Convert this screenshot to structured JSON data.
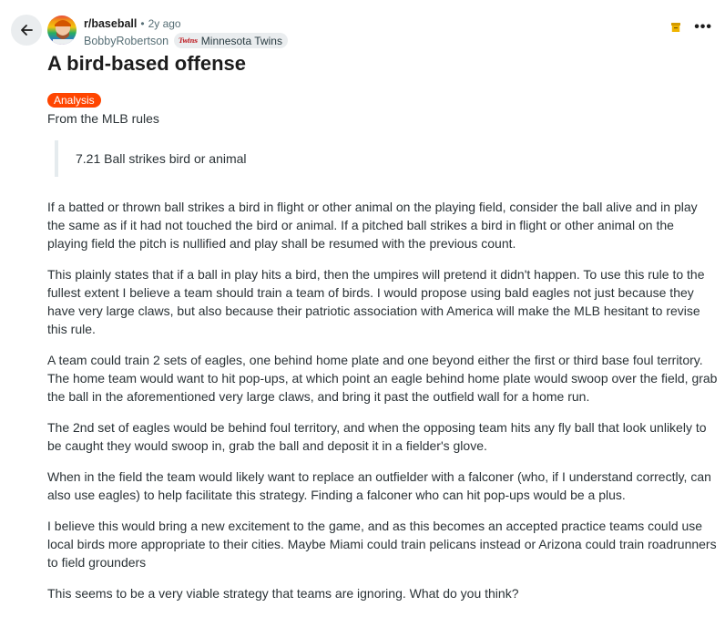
{
  "header": {
    "back_icon": "arrow-left-icon",
    "subreddit": "r/baseball",
    "separator": "•",
    "timestamp": "2y ago",
    "username": "BobbyRobertson",
    "user_flair": "Minnesota Twins",
    "user_flair_logo": "Twins",
    "save_icon": "archive-icon",
    "more_icon": "more-horizontal-icon",
    "more_label": "•••"
  },
  "post": {
    "title": "A bird-based offense",
    "flair": "Analysis",
    "flair_color": "#ff4500",
    "intro": "From the MLB rules",
    "quote": "7.21 Ball strikes bird or animal",
    "paragraphs": [
      "If a batted or thrown ball strikes a bird in flight or other animal on the playing field, consider the ball alive and in play the same as if it had not touched the bird or animal. If a pitched ball strikes a bird in flight or other animal on the playing field the pitch is nullified and play shall be resumed with the previous count.",
      "This plainly states that if a ball in play hits a bird, then the umpires will pretend it didn't happen. To use this rule to the fullest extent I believe a team should train a team of birds. I would propose using bald eagles not just because they have very large claws, but also because their patriotic association with America will make the MLB hesitant to revise this rule.",
      "A team could train 2 sets of eagles, one behind home plate and one beyond either the first or third base foul territory. The home team would want to hit pop-ups, at which point an eagle behind home plate would swoop over the field, grab the ball in the aforementioned very large claws, and bring it past the outfield wall for a home run.",
      "The 2nd set of eagles would be behind foul territory, and when the opposing team hits any fly ball that look unlikely to be caught they would swoop in, grab the ball and deposit it in a fielder's glove.",
      "When in the field the team would likely want to replace an outfielder with a falconer (who, if I understand correctly, can also use eagles) to help facilitate this strategy. Finding a falconer who can hit pop-ups would be a plus.",
      "I believe this would bring a new excitement to the game, and as this becomes an accepted practice teams could use local birds more appropriate to their cities. Maybe Miami could train pelicans instead or Arizona could train roadrunners to field grounders",
      "This seems to be a very viable strategy that teams are ignoring. What do you think?"
    ]
  }
}
